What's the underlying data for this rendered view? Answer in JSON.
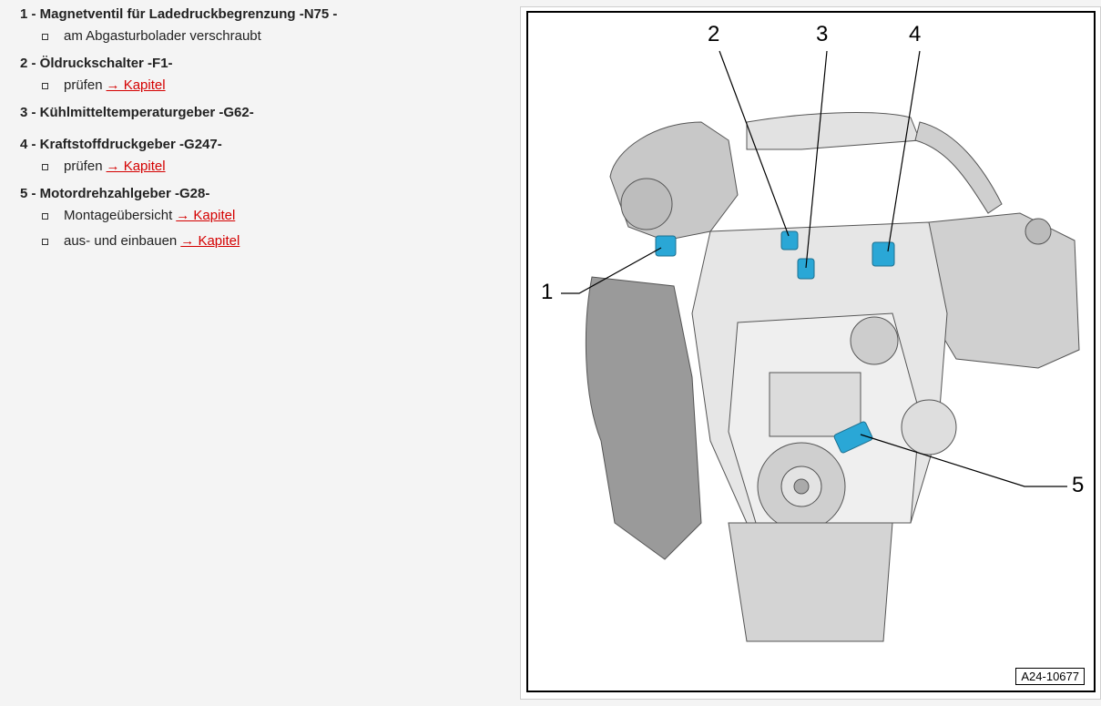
{
  "items": [
    {
      "title": "1 - Magnetventil für Ladedruckbegrenzung -N75 -",
      "subs": [
        {
          "text": "am Abgasturbolader verschraubt"
        }
      ]
    },
    {
      "title": "2 - Öldruckschalter -F1-",
      "subs": [
        {
          "text": "prüfen",
          "link": "→ Kapitel"
        }
      ]
    },
    {
      "title": "3 - Kühlmitteltemperaturgeber -G62-",
      "subs": []
    },
    {
      "title": "4 - Kraftstoffdruckgeber -G247-",
      "subs": [
        {
          "text": "prüfen",
          "link": "→ Kapitel"
        }
      ]
    },
    {
      "title": "5 - Motordrehzahlgeber -G28-",
      "subs": [
        {
          "text": "Montageübersicht",
          "link": "→ Kapitel"
        },
        {
          "text": "aus- und einbauen",
          "link": "→ Kapitel"
        }
      ]
    }
  ],
  "figure": {
    "callouts": [
      "1",
      "2",
      "3",
      "4",
      "5"
    ],
    "reference": "A24-10677",
    "highlight_color": "#2aa7d6"
  }
}
